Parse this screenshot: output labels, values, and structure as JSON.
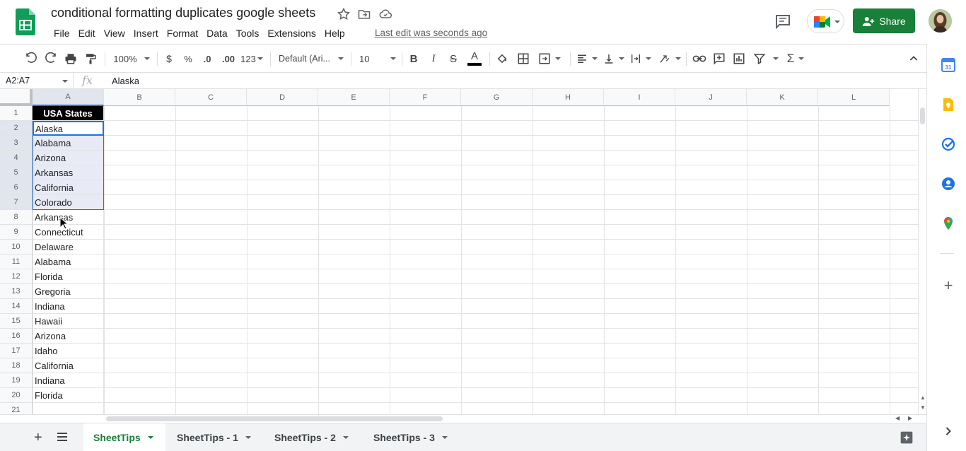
{
  "doc": {
    "title": "conditional formatting duplicates google sheets",
    "last_edit": "Last edit was seconds ago"
  },
  "menu": [
    "File",
    "Edit",
    "View",
    "Insert",
    "Format",
    "Data",
    "Tools",
    "Extensions",
    "Help"
  ],
  "header": {
    "share_label": "Share"
  },
  "toolbar": {
    "zoom": "100%",
    "currency": "$",
    "percent": "%",
    "dec_decrease": ".0",
    "dec_increase": ".00",
    "more_formats": "123",
    "font": "Default (Ari...",
    "font_size": "10",
    "bold": "B",
    "italic": "I",
    "strike": "S",
    "text_color": "A"
  },
  "formula_bar": {
    "name_box": "A2:A7",
    "fx": "fx",
    "content": "Alaska"
  },
  "columns": [
    "A",
    "B",
    "C",
    "D",
    "E",
    "F",
    "G",
    "H",
    "I",
    "J",
    "K",
    "L"
  ],
  "rows": [
    "1",
    "2",
    "3",
    "4",
    "5",
    "6",
    "7",
    "8",
    "9",
    "10",
    "11",
    "12",
    "13",
    "14",
    "15",
    "16",
    "17",
    "18",
    "19",
    "20",
    "21"
  ],
  "column_a": [
    "USA States",
    "Alaska",
    "Alabama",
    "Arizona",
    "Arkansas",
    "California",
    "Colorado",
    "Arkansas",
    "Connecticut",
    "Delaware",
    "Alabama",
    "Florida",
    "Gregoria",
    "Indiana",
    "Hawaii",
    "Arizona",
    "Idaho",
    "California",
    "Indiana",
    "Florida",
    ""
  ],
  "sheets": [
    {
      "label": "SheetTips",
      "active": true
    },
    {
      "label": "SheetTips - 1",
      "active": false
    },
    {
      "label": "SheetTips - 2",
      "active": false
    },
    {
      "label": "SheetTips - 3",
      "active": false
    }
  ],
  "colors": {
    "accent": "#188038",
    "selection": "#e8eaf6",
    "selection_border": "#1a73e8",
    "header_fill": "#000000"
  }
}
